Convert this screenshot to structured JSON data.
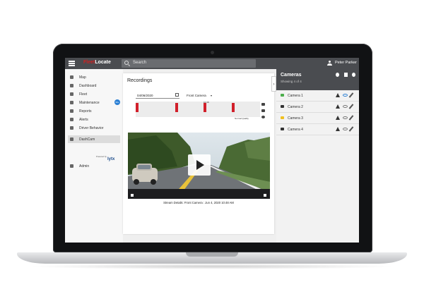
{
  "app": {
    "logo_part1": "Fleet",
    "logo_part2": "Locate"
  },
  "topbar": {
    "search_placeholder": "Search",
    "user_name": "Peter Parker"
  },
  "sidebar": {
    "items": [
      {
        "label": "Map",
        "icon": "map-icon"
      },
      {
        "label": "Dashboard",
        "icon": "dashboard-icon"
      },
      {
        "label": "Fleet",
        "icon": "fleet-icon"
      },
      {
        "label": "Maintenance",
        "icon": "wrench-icon",
        "badge": "99+"
      },
      {
        "label": "Reports",
        "icon": "report-icon"
      },
      {
        "label": "Alerts",
        "icon": "alert-icon"
      },
      {
        "label": "Driver Behavior",
        "icon": "driver-icon"
      },
      {
        "label": "DashCam",
        "icon": "camera-icon",
        "active": true
      },
      {
        "label": "Admin",
        "icon": "gear-icon"
      }
    ],
    "powered_by": "Powered by",
    "partner": "lytx"
  },
  "recordings": {
    "title": "Recordings",
    "date": "04/06/2020",
    "camera": "Front Camera",
    "time_marker": "10:48",
    "quality": "Normal Quality",
    "caption": "Stream Details: Front Camera : Jun 4, 2020 10:48 AM"
  },
  "cameras_panel": {
    "title": "Cameras",
    "subtitle": "Showing 4 of 4",
    "cameras": [
      {
        "label": "Camera 1",
        "color": "#4cae4c",
        "visible": true
      },
      {
        "label": "Camera 2",
        "color": "#333333",
        "visible": false
      },
      {
        "label": "Camera 3",
        "color": "#f0c020",
        "visible": false
      },
      {
        "label": "Camera 4",
        "color": "#333333",
        "visible": false
      }
    ]
  },
  "colors": {
    "topbar": "#4a4c50",
    "accent_red": "#d11f2a",
    "accent_blue": "#2a7fd4"
  }
}
